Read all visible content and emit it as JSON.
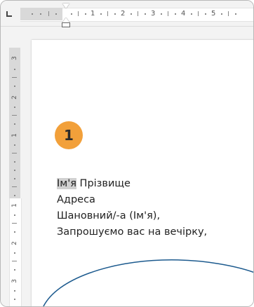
{
  "horizontal_ruler": {
    "numbers": [
      "1",
      "2",
      "3",
      "4",
      "5"
    ]
  },
  "vertical_ruler": {
    "numbers": [
      "3",
      "2",
      "1",
      "1",
      "2",
      "3"
    ]
  },
  "step_badge": {
    "number": "1",
    "color": "#f2a03a"
  },
  "document": {
    "line1_placeholder": "Ім'я",
    "line1_rest": " Прізвище",
    "line2": "Адреса",
    "line3": "Шановний/-а (Ім'я),",
    "line4": "Запрошуємо вас на вечірку,"
  },
  "colors": {
    "accent": "#f2a03a",
    "shape_stroke": "#1c5a8e"
  }
}
